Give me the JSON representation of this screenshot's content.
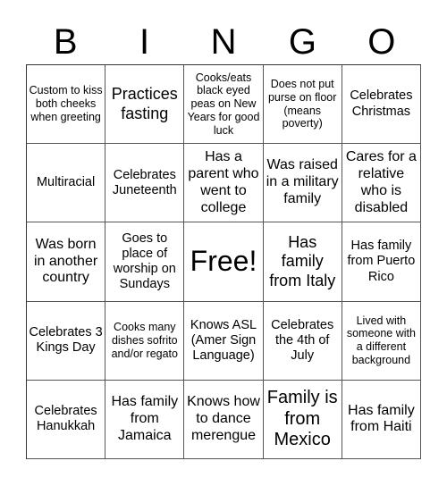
{
  "header": [
    "B",
    "I",
    "N",
    "G",
    "O"
  ],
  "cells": [
    {
      "text": "Custom to kiss both cheeks when greeting",
      "size": "s12"
    },
    {
      "text": "Practices fasting",
      "size": "s18"
    },
    {
      "text": "Cooks/eats black eyed peas on New Years for good luck",
      "size": "s12"
    },
    {
      "text": "Does not put purse on floor (means poverty)",
      "size": "s12"
    },
    {
      "text": "Celebrates Christmas",
      "size": "s14"
    },
    {
      "text": "Multiracial",
      "size": "s14"
    },
    {
      "text": "Celebrates Juneteenth",
      "size": "s14"
    },
    {
      "text": "Has a parent who went to college",
      "size": "s16"
    },
    {
      "text": "Was raised in a military family",
      "size": "s16"
    },
    {
      "text": "Cares for a relative who is disabled",
      "size": "s16"
    },
    {
      "text": "Was born in another country",
      "size": "s16"
    },
    {
      "text": "Goes to place of worship on Sundays",
      "size": "s14"
    },
    {
      "text": "Free!",
      "size": "free"
    },
    {
      "text": "Has family from Italy",
      "size": "s18"
    },
    {
      "text": "Has family from Puerto Rico",
      "size": "s14"
    },
    {
      "text": "Celebrates 3 Kings Day",
      "size": "s14"
    },
    {
      "text": "Cooks many dishes sofrito and/or regato",
      "size": "s12"
    },
    {
      "text": "Knows ASL (Amer Sign Language)",
      "size": "s14"
    },
    {
      "text": "Celebrates the 4th of July",
      "size": "s14"
    },
    {
      "text": "Lived with someone with a different background",
      "size": "s12"
    },
    {
      "text": "Celebrates Hanukkah",
      "size": "s14"
    },
    {
      "text": "Has family from Jamaica",
      "size": "s16"
    },
    {
      "text": "Knows how to dance merengue",
      "size": "s16"
    },
    {
      "text": "Family is from Mexico",
      "size": "s20"
    },
    {
      "text": "Has family from Haiti",
      "size": "s16"
    }
  ]
}
